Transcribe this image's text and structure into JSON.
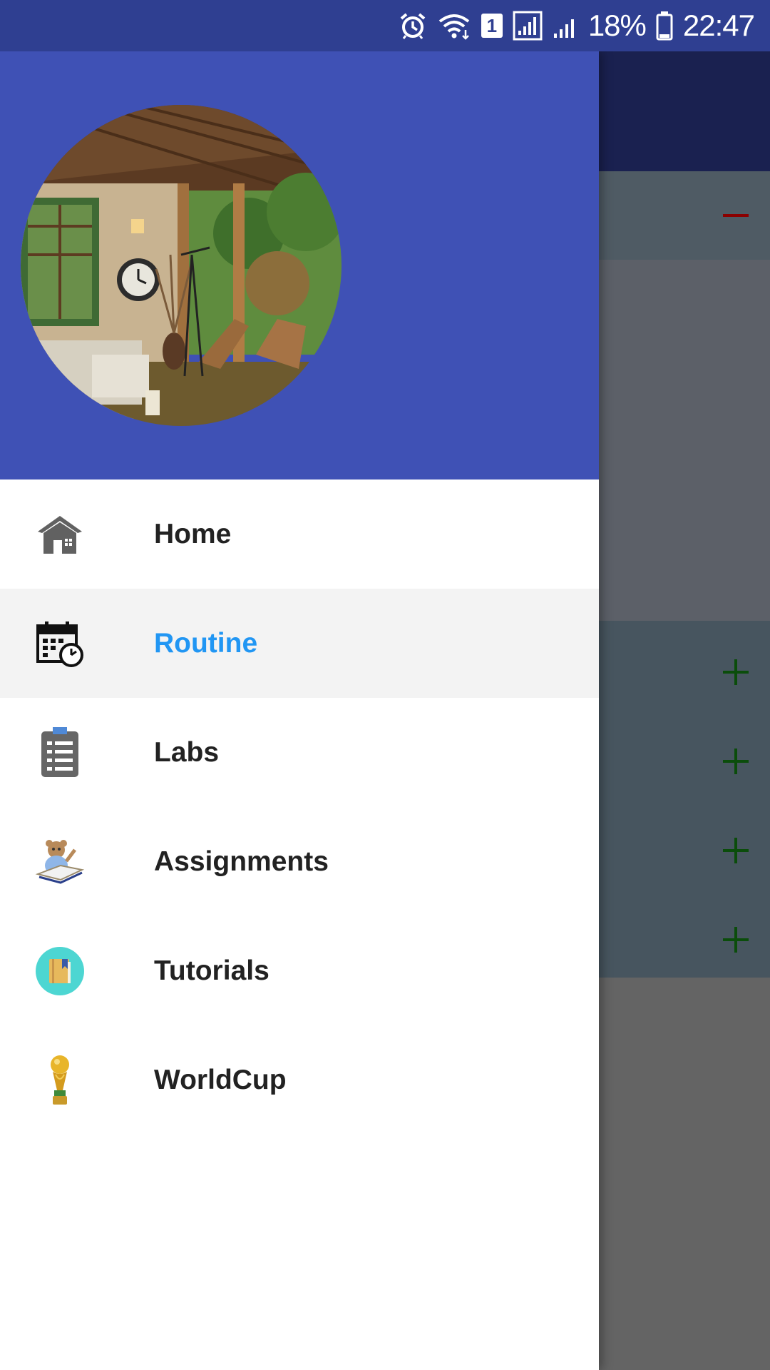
{
  "status_bar": {
    "battery_percent": "18%",
    "time": "22:47",
    "sim_slot": "1",
    "icons": [
      "alarm-icon",
      "wifi-icon",
      "sim-icon",
      "signal-icon",
      "signal-icon",
      "battery-icon"
    ]
  },
  "drawer": {
    "header_color": "#3f51b5",
    "avatar": "porch-interior-photo",
    "items": [
      {
        "label": "Home",
        "icon": "home-icon",
        "active": false
      },
      {
        "label": "Routine",
        "icon": "calendar-clock-icon",
        "active": true
      },
      {
        "label": "Labs",
        "icon": "clipboard-list-icon",
        "active": false
      },
      {
        "label": "Assignments",
        "icon": "bear-reading-icon",
        "active": false
      },
      {
        "label": "Tutorials",
        "icon": "book-icon",
        "active": false
      },
      {
        "label": "WorldCup",
        "icon": "trophy-icon",
        "active": false
      }
    ],
    "active_color": "#2196f3"
  },
  "background": {
    "buttons": [
      {
        "icon": "minus-icon",
        "color": "#8b0000"
      },
      {
        "icon": "plus-icon",
        "color": "#0b4d0b"
      },
      {
        "icon": "plus-icon",
        "color": "#0b4d0b"
      },
      {
        "icon": "plus-icon",
        "color": "#0b4d0b"
      },
      {
        "icon": "plus-icon",
        "color": "#0b4d0b"
      }
    ]
  }
}
